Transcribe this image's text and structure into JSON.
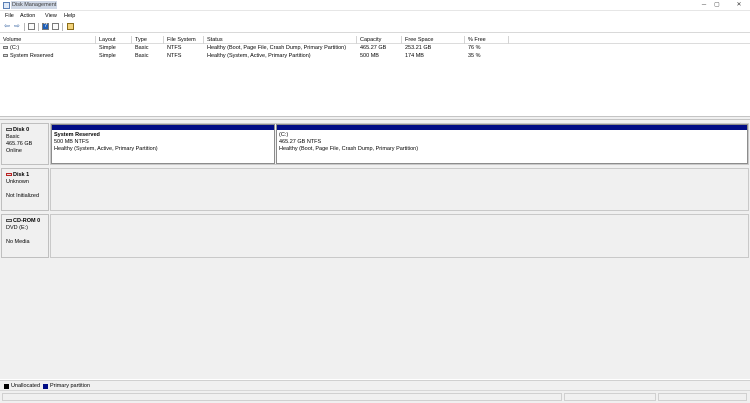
{
  "window": {
    "title": "Disk Management",
    "minimize": "─",
    "maximize": "▢",
    "close": "✕"
  },
  "menu": {
    "file": "File",
    "action": "Action",
    "view": "View",
    "help": "Help"
  },
  "toolbar": {
    "back": "⇦",
    "forward": "⇨",
    "help": "?"
  },
  "volume_list": {
    "columns": [
      "Volume",
      "Layout",
      "Type",
      "File System",
      "Status",
      "Capacity",
      "Free Space",
      "% Free"
    ],
    "rows": [
      {
        "volume": "(C:)",
        "layout": "Simple",
        "type": "Basic",
        "fs": "NTFS",
        "status": "Healthy (Boot, Page File, Crash Dump, Primary Partition)",
        "capacity": "465.27 GB",
        "free": "253.21 GB",
        "pct": "76 %"
      },
      {
        "volume": "System Reserved",
        "layout": "Simple",
        "type": "Basic",
        "fs": "NTFS",
        "status": "Healthy (System, Active, Primary Partition)",
        "capacity": "500 MB",
        "free": "174 MB",
        "pct": "35 %"
      }
    ]
  },
  "disks": [
    {
      "name": "Disk 0",
      "type": "Basic",
      "size": "465.76 GB",
      "state": "Online",
      "partitions": [
        {
          "title": "System Reserved",
          "size": "500 MB NTFS",
          "status": "Healthy (System, Active, Primary Partition)"
        },
        {
          "title": "(C:)",
          "size": "465.27 GB NTFS",
          "status": "Healthy (Boot, Page File, Crash Dump, Primary Partition)"
        }
      ]
    },
    {
      "name": "Disk 1",
      "type": "Unknown",
      "state": "Not Initialized"
    },
    {
      "name": "CD-ROM 0",
      "type": "DVD (E:)",
      "state": "No Media"
    }
  ],
  "legend": {
    "unallocated": "Unallocated",
    "primary": "Primary partition"
  },
  "colors": {
    "primary_partition": "#000c85",
    "unallocated": "#000000"
  }
}
